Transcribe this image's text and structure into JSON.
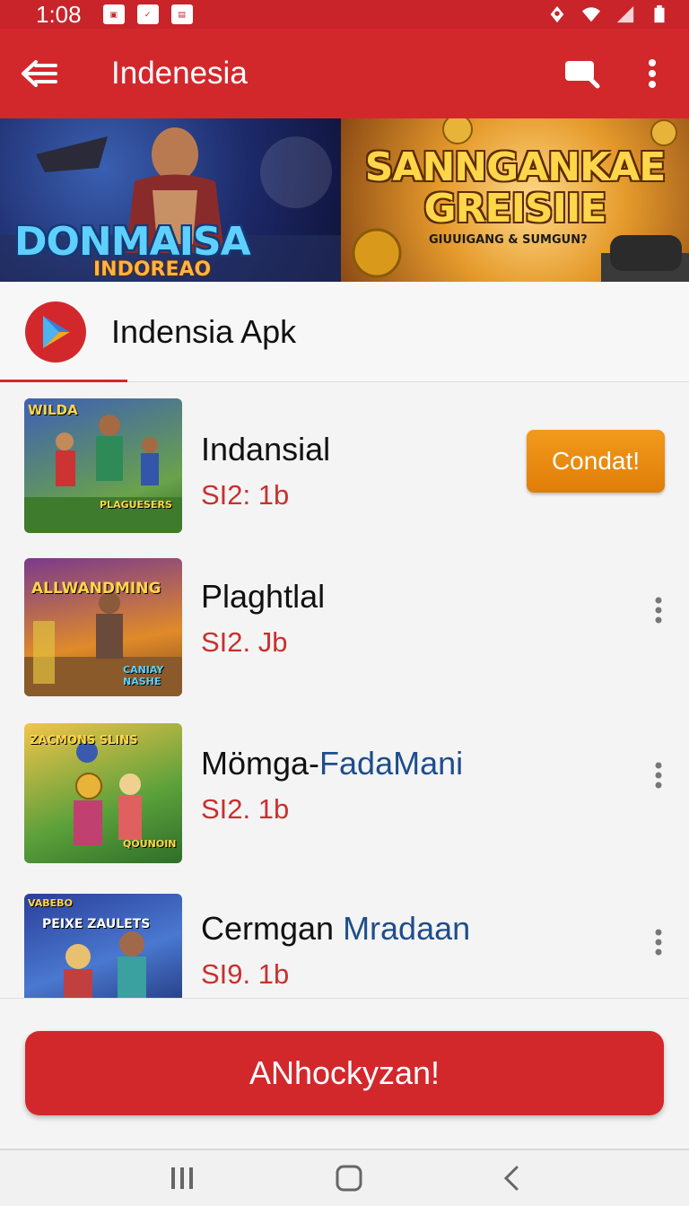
{
  "status_bar": {
    "time": "1:08",
    "notif_icons": [
      "notification-icon-1",
      "notification-icon-2",
      "notification-icon-3"
    ],
    "right_icons": [
      "location-icon",
      "wifi-icon",
      "signal-icon",
      "battery-icon"
    ]
  },
  "app_bar": {
    "title": "Indenesia",
    "icons": [
      "menu-icon",
      "search-icon",
      "more-vert-icon"
    ]
  },
  "banner": {
    "left_title": "DONMAISA",
    "left_subtitle": "INDOREAO",
    "right_title_line1": "SANNGANKAE",
    "right_title_line2": "GREISIIE",
    "right_subtitle": "GIUUIGANG & SUMGUN?"
  },
  "section": {
    "title": "Indensia Apk",
    "icon": "play-store-icon"
  },
  "apps": [
    {
      "name": "Indansial",
      "name_accent": "",
      "size": "SI2: 1b",
      "action_label": "Condat!",
      "thumb_label": "WILDA",
      "thumb_label2": "PLAGUESERS"
    },
    {
      "name": "Plaghtlal",
      "name_accent": "",
      "size": "SI2. Jb",
      "action_label": "",
      "thumb_label": "ALLWANDMING",
      "thumb_label2": "CANIAY NASHE"
    },
    {
      "name": "Mömga-",
      "name_accent": "FadaMani",
      "size": "SI2. 1b",
      "action_label": "",
      "thumb_label": "ZACMONS SLINS",
      "thumb_label2": "QOUNOIN"
    },
    {
      "name": "Cermgan ",
      "name_accent": "Mradaan",
      "size": "SI9. 1b",
      "action_label": "",
      "thumb_label": "VABEBO",
      "thumb_label2": "PEIXE ZAULETS"
    }
  ],
  "primary_button": {
    "label": "ANhockyzan!"
  },
  "nav_bar": {
    "icons": [
      "recents-icon",
      "home-icon",
      "back-icon"
    ]
  },
  "colors": {
    "brand_red": "#d2282c",
    "install_orange": "#ef8f12",
    "size_red": "#c8302e",
    "accent_blue": "#1e4e8c"
  }
}
